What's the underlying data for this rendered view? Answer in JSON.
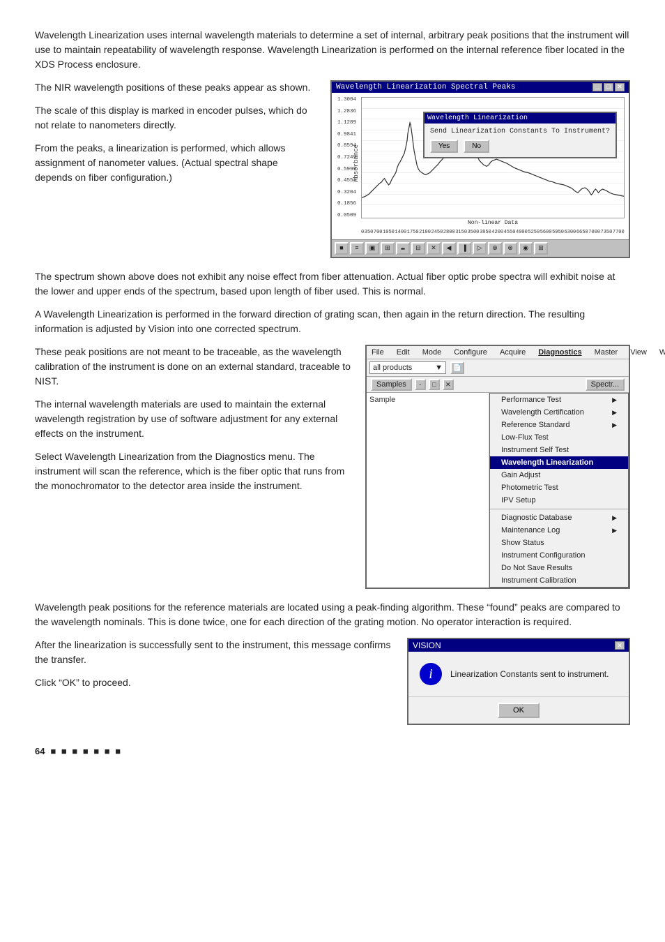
{
  "intro": {
    "para1": "Wavelength Linearization uses internal wavelength materials to determine a set of internal, arbitrary peak positions that the instrument will use to maintain repeatability of wavelength response. Wavelength Linearization is performed on the internal reference fiber located in the XDS Process enclosure.",
    "para2": "The NIR wavelength positions of these peaks appear as shown.",
    "para3": "The scale of this display is marked in encoder pulses, which do not relate to nanometers directly.",
    "para4": "From the peaks, a linearization is performed, which allows assignment of nanometer values. (Actual spectral shape depends on fiber configuration.)",
    "para5": "The spectrum shown above does not exhibit any noise effect from fiber attenuation. Actual fiber optic probe spectra will exhibit noise at the lower and upper ends of the spectrum, based upon length of fiber used. This is normal.",
    "para6": "A Wavelength Linearization is performed in the forward direction of grating scan, then again in the return direction. The resulting information is adjusted by Vision into one corrected spectrum.",
    "para7": "These peak positions are not meant to be traceable, as the wavelength calibration of the instrument is done on an external standard, traceable to NIST.",
    "para8": "The internal wavelength materials are used to maintain the external wavelength registration by use of software adjustment for any external effects on the instrument.",
    "para9": "Select Wavelength Linearization from the Diagnostics menu. The instrument will scan the reference, which is the fiber optic that runs from the monochromator to the detector area inside the instrument.",
    "para10": "Wavelength peak positions for the reference materials are located using a peak-finding algorithm. These “found” peaks are compared to the wavelength nominals. This is done twice, one for each direction of the grating motion. No operator interaction is required.",
    "para11": "After the linearization is successfully sent to the instrument, this message confirms the transfer.",
    "para12": "Click “OK” to proceed."
  },
  "spectral_window": {
    "title": "Wavelength Linearization Spectral Peaks",
    "y_axis_label": "Absorbance",
    "x_axis_label": "Non-linear Data",
    "y_values": [
      "1.3004",
      "1.2836",
      "1.1289",
      "0.9841",
      "0.8594",
      "0.7249",
      "0.5999",
      "0.4551",
      "0.3204",
      "0.1856",
      "0.0509"
    ],
    "x_values": "0  350 700 1050 1400 1750 2100 2450 2800 3150 3500 3850 4200 4550 4900 5250 5600 5950 6300 6650 7000 7350 7700",
    "dialog": {
      "title": "Wavelength Linearization",
      "question": "Send Linearization Constants To Instrument?",
      "yes_label": "Yes",
      "no_label": "No"
    }
  },
  "diag_window": {
    "menubar": [
      "File",
      "Edit",
      "Mode",
      "Configure",
      "Acquire",
      "Diagnostics",
      "Master",
      "View",
      "Wi"
    ],
    "dropdown_value": "all products",
    "samples_label": "Samples",
    "sample_area_label": "Sample",
    "spectra_tab": "Spectr...",
    "menu_items": [
      {
        "label": "Performance Test",
        "has_arrow": true
      },
      {
        "label": "Wavelength Certification",
        "has_arrow": true
      },
      {
        "label": "Reference Standard",
        "has_arrow": true
      },
      {
        "label": "Low-Flux Test",
        "has_arrow": false
      },
      {
        "label": "Instrument Self Test",
        "has_arrow": false
      },
      {
        "label": "Wavelength Linearization",
        "has_arrow": false,
        "active": true
      },
      {
        "label": "Gain Adjust",
        "has_arrow": false
      },
      {
        "label": "Photometric Test",
        "has_arrow": false
      },
      {
        "label": "IPV Setup",
        "has_arrow": false
      },
      {
        "label": "Diagnostic Database",
        "has_arrow": true,
        "separator": true
      },
      {
        "label": "Maintenance Log",
        "has_arrow": true
      },
      {
        "label": "Show Status",
        "has_arrow": false
      },
      {
        "label": "Instrument Configuration",
        "has_arrow": false
      },
      {
        "label": "Do Not Save Results",
        "has_arrow": false
      },
      {
        "label": "Instrument Calibration",
        "has_arrow": false
      }
    ]
  },
  "vision_dialog": {
    "title": "VISION",
    "message": "Linearization Constants sent to instrument.",
    "ok_label": "OK"
  },
  "page_footer": {
    "number": "64",
    "dots": "■ ■ ■ ■ ■ ■ ■"
  }
}
